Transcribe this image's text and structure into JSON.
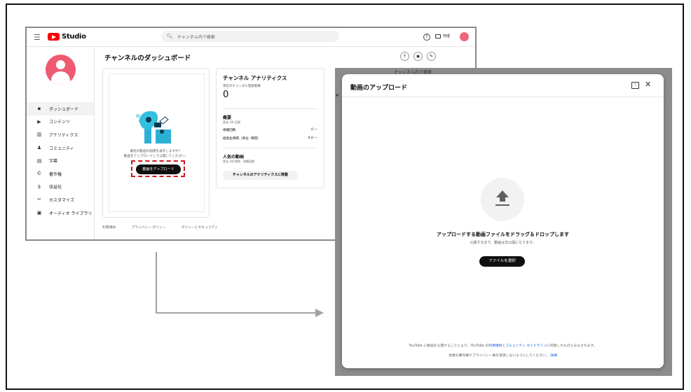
{
  "studio": {
    "logo_text": "Studio",
    "search_placeholder": "チャンネル内で検索",
    "create_label": "作成"
  },
  "sidebar": {
    "items": [
      {
        "icon": "dashboard-icon",
        "glyph": "▪",
        "label": "ダッシュボード",
        "active": true
      },
      {
        "icon": "content-icon",
        "glyph": "▶",
        "label": "コンテンツ"
      },
      {
        "icon": "analytics-icon",
        "glyph": "▥",
        "label": "アナリティクス"
      },
      {
        "icon": "community-icon",
        "glyph": "♟",
        "label": "コミュニティ"
      },
      {
        "icon": "subtitles-icon",
        "glyph": "▤",
        "label": "字幕"
      },
      {
        "icon": "copyright-icon",
        "glyph": "©",
        "label": "著作権"
      },
      {
        "icon": "earn-icon",
        "glyph": "$",
        "label": "収益化"
      },
      {
        "icon": "customize-icon",
        "glyph": "✂",
        "label": "カスタマイズ"
      },
      {
        "icon": "audio-library-icon",
        "glyph": "▣",
        "label": "オーディオ ライブラリ"
      }
    ]
  },
  "dashboard": {
    "title": "チャンネルのダッシュボード",
    "upload_prompt_1": "最近の動画の指標を表示しますか？",
    "upload_prompt_2": "動画をアップロードして公開してください。",
    "upload_button": "動画をアップロード"
  },
  "analytics": {
    "title": "チャンネル アナリティクス",
    "subscribers_label": "現在のチャンネル登録者数",
    "subscribers": "0",
    "summary_title": "概要",
    "summary_period": "過去 28 日間",
    "views_label": "視聴回数",
    "views_value": "0 —",
    "watch_label": "総再生時間（単位: 時間）",
    "watch_value": "0.0 —",
    "top_title": "人気の動画",
    "top_period": "過去 48 時間 · 視聴回数",
    "go_button": "チャンネルのアナリティクスに移動"
  },
  "footer": {
    "terms": "利用規約",
    "privacy": "プライバシー ポリシー",
    "policy": "ポリシーとセキュリティ"
  },
  "backdrop": {
    "search_snippet": "チャンネル内で検索",
    "kana": "ャ"
  },
  "modal": {
    "title": "動画のアップロード",
    "drop_text": "アップロードする動画ファイルをドラッグ＆ドロップします",
    "private_note": "公開するまで、動画は非公開になります。",
    "select_button": "ファイルを選択",
    "terms_pre": "YouTube に動画を公開することにより、YouTube の",
    "terms_link1": "利用規約",
    "terms_mid": "と",
    "terms_link2": "コミュニティ ガイドライン",
    "terms_post": "に同意したものとみなされます。",
    "terms2_text": "他者の著作権やプライバシー権を侵害しないようにしてください。",
    "terms2_link": "詳細"
  }
}
